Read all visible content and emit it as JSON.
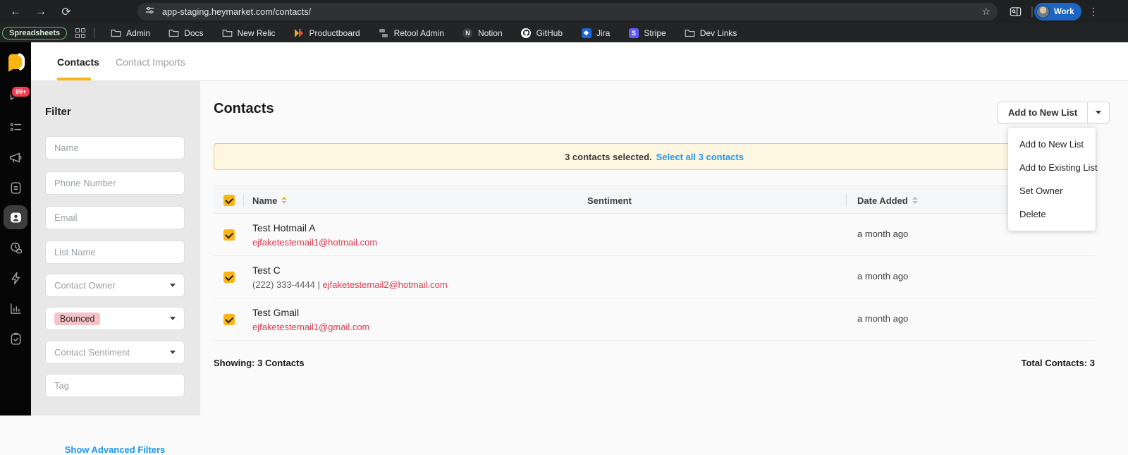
{
  "colors": {
    "accent_yellow": "#f9b514",
    "link_blue": "#2196f3",
    "email_red": "#e0384d",
    "badge_red": "#f43b4f",
    "banner_bg": "#fdf7e2",
    "banner_border": "#efc675",
    "bounced_pill_bg": "#f5c2c7",
    "profile_pill_blue": "#1a66c2",
    "bookmark_group_green": "#69b978"
  },
  "browser": {
    "url": "app-staging.heymarket.com/contacts/",
    "profile_label": "Work",
    "bookmarks": {
      "group_label": "Spreadsheets",
      "items": [
        {
          "label": "Admin",
          "icon": "folder"
        },
        {
          "label": "Docs",
          "icon": "folder"
        },
        {
          "label": "New Relic",
          "icon": "folder"
        },
        {
          "label": "Productboard",
          "icon": "productboard"
        },
        {
          "label": "Retool Admin",
          "icon": "retool"
        },
        {
          "label": "Notion",
          "icon": "notion"
        },
        {
          "label": "GitHub",
          "icon": "github"
        },
        {
          "label": "Jira",
          "icon": "jira"
        },
        {
          "label": "Stripe",
          "icon": "stripe"
        },
        {
          "label": "Dev Links",
          "icon": "folder"
        }
      ]
    }
  },
  "sidebar": {
    "unread_badge": "99+"
  },
  "nav_tabs": {
    "contacts": "Contacts",
    "contact_imports": "Contact Imports"
  },
  "filter": {
    "title": "Filter",
    "name_placeholder": "Name",
    "phone_placeholder": "Phone Number",
    "email_placeholder": "Email",
    "list_placeholder": "List Name",
    "owner_placeholder": "Contact Owner",
    "bounced_tag": "Bounced",
    "sentiment_placeholder": "Contact Sentiment",
    "tag_placeholder": "Tag",
    "advanced_link": "Show Advanced Filters"
  },
  "main": {
    "title": "Contacts",
    "add_button": "Add to New List",
    "menu": [
      "Add to New List",
      "Add to Existing List",
      "Set Owner",
      "Delete"
    ],
    "banner": {
      "text": "3 contacts selected.",
      "link": "Select all 3 contacts"
    },
    "table": {
      "col_name": "Name",
      "col_sentiment": "Sentiment",
      "col_date": "Date Added",
      "rows": [
        {
          "name": "Test Hotmail A",
          "phone": "",
          "sep": "",
          "email": "ejfaketestemail1@hotmail.com",
          "date": "a month ago"
        },
        {
          "name": "Test C",
          "phone": "(222) 333-4444",
          "sep": " | ",
          "email": "ejfaketestemail2@hotmail.com",
          "date": "a month ago"
        },
        {
          "name": "Test Gmail",
          "phone": "",
          "sep": "",
          "email": "ejfaketestemail1@gmail.com",
          "date": "a month ago"
        }
      ]
    },
    "footer": {
      "showing": "Showing: 3 Contacts",
      "total": "Total Contacts: 3"
    }
  }
}
